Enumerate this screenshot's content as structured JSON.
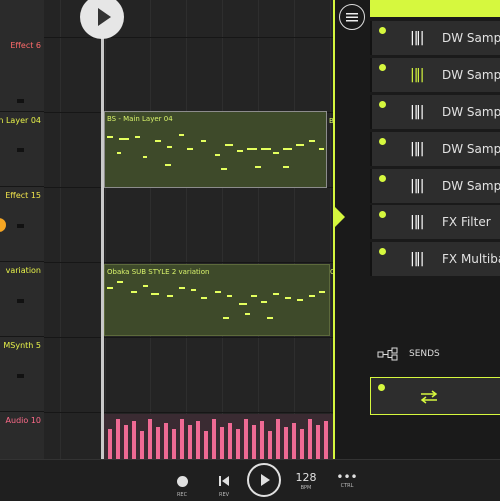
{
  "colors": {
    "accent": "#d6f83e",
    "note": "#e4ff5e",
    "audio": "#ef6a94",
    "red_label": "#ff5f5f",
    "yellow_label": "#f0e44c",
    "orange_knob": "#f6a623"
  },
  "tracks": [
    {
      "name": "Effect 6",
      "color": "#ff6b6b"
    },
    {
      "name": "n Layer 04",
      "color": "#e8f34a"
    },
    {
      "name": "Effect 15",
      "color": "#f0e44c"
    },
    {
      "name": "variation",
      "color": "#e8f34a"
    },
    {
      "name": "MSynth 5",
      "color": "#e8f34a"
    },
    {
      "name": "Audio 10",
      "color": "#ff6b8a"
    }
  ],
  "clips": {
    "clip1_title": "BS - Main Layer 04",
    "clip1_cut": "B",
    "clip2_title": "Obaka SUB STYLE 2 variation",
    "clip2_cut": "O"
  },
  "panel": {
    "slots": [
      {
        "label": "DW Sampler",
        "icon": "sliders-icon"
      },
      {
        "label": "DW Sampler",
        "icon": "sliders-icon"
      },
      {
        "label": "DW Sampler",
        "icon": "sliders-icon"
      },
      {
        "label": "DW Sampler",
        "icon": "sliders-icon"
      },
      {
        "label": "DW Sampler",
        "icon": "sliders-icon"
      },
      {
        "label": "FX Filter",
        "icon": "sliders-icon"
      },
      {
        "label": "FX Multiband",
        "icon": "sliders-icon"
      }
    ],
    "sends_label": "SENDS",
    "send_icon": "swap-arrows-icon"
  },
  "transport": {
    "rec": "REC",
    "rev": "REV",
    "bpm_value": "128",
    "bpm": "BPM",
    "ctrl": "CTRL"
  }
}
